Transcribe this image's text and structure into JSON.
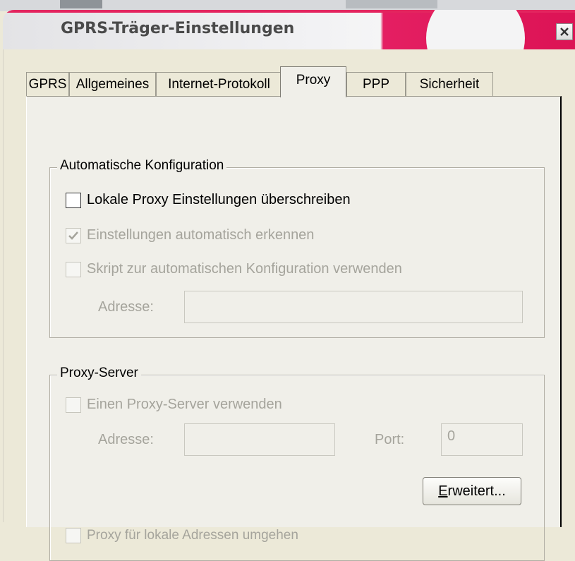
{
  "window": {
    "title": "GPRS-Träger-Einstellungen",
    "close_icon": "close-icon"
  },
  "tabs": [
    {
      "label": "GPRS",
      "active": false
    },
    {
      "label": "Allgemeines",
      "active": false
    },
    {
      "label": "Internet-Protokoll",
      "active": false
    },
    {
      "label": "Proxy",
      "active": true
    },
    {
      "label": "PPP",
      "active": false
    },
    {
      "label": "Sicherheit",
      "active": false
    }
  ],
  "auto_config": {
    "title": "Automatische Konfiguration",
    "override_label": "Lokale Proxy Einstellungen überschreiben",
    "override_checked": false,
    "autodetect_label": "Einstellungen automatisch erkennen",
    "autodetect_checked": true,
    "script_label": "Skript zur automatischen Konfiguration verwenden",
    "script_checked": false,
    "address_label": "Adresse:",
    "address_value": ""
  },
  "proxy_server": {
    "title": "Proxy-Server",
    "use_proxy_label": "Einen Proxy-Server verwenden",
    "use_proxy_checked": false,
    "address_label": "Adresse:",
    "address_value": "",
    "port_label": "Port:",
    "port_value": "0",
    "advanced_button_label_accel": "E",
    "advanced_button_label_rest": "rweitert...",
    "bypass_label": "Proxy für lokale Adressen umgehen",
    "bypass_checked": false
  },
  "colors": {
    "title_accent": "#e41f62",
    "face": "#ece9d8",
    "disabled_text": "#a5a49c"
  }
}
